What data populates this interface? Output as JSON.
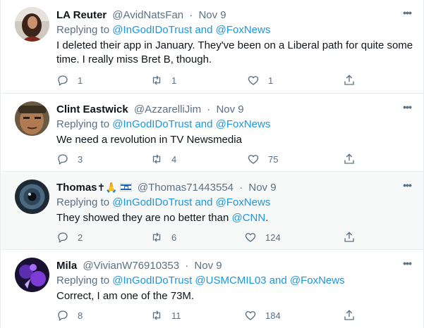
{
  "tweets": [
    {
      "name": "LA Reuter",
      "handle": "@AvidNatsFan",
      "dot": "·",
      "date": "Nov 9",
      "replying_prefix": "Replying to",
      "replying_mentions": "@InGodIDoTrust and @FoxNews",
      "text": "I deleted their app in January.  They've been on a Liberal path for quite some time.  I really miss Bret B, though.",
      "replies": "1",
      "retweets": "1",
      "likes": "1",
      "more_icon": "more-icon"
    },
    {
      "name": "Clint Eastwick",
      "handle": "@AzzarelliJim",
      "dot": "·",
      "date": "Nov 9",
      "replying_prefix": "Replying to",
      "replying_mentions": "@InGodIDoTrust and @FoxNews",
      "text": "We need a revolution in TV Newsmedia",
      "replies": "3",
      "retweets": "4",
      "likes": "75",
      "more_icon": "more-icon"
    },
    {
      "name": "Thomas",
      "name_emoji": "✝🙏",
      "handle": "@Thomas71443554",
      "dot": "·",
      "date": "Nov 9",
      "replying_prefix": "Replying to",
      "replying_mentions": "@InGodIDoTrust and @FoxNews",
      "text_before": "They showed they are no better than ",
      "text_link": "@CNN",
      "text_after": ".",
      "replies": "2",
      "retweets": "6",
      "likes": "124",
      "more_icon": "more-icon"
    },
    {
      "name": "Mila",
      "handle": "@VivianW76910353",
      "dot": "·",
      "date": "Nov 9",
      "replying_prefix": "Replying to",
      "replying_mentions": "@InGodIDoTrust @USMCMIL03 and @FoxNews",
      "text": "Correct, I am one of the 73M.",
      "replies": "8",
      "retweets": "11",
      "likes": "184",
      "more_icon": "more-icon"
    }
  ],
  "colors": {
    "link": "#1b95e0",
    "muted": "#5b7083",
    "highlight_row": "#f7f9f9",
    "divider": "#e6ecf0"
  }
}
